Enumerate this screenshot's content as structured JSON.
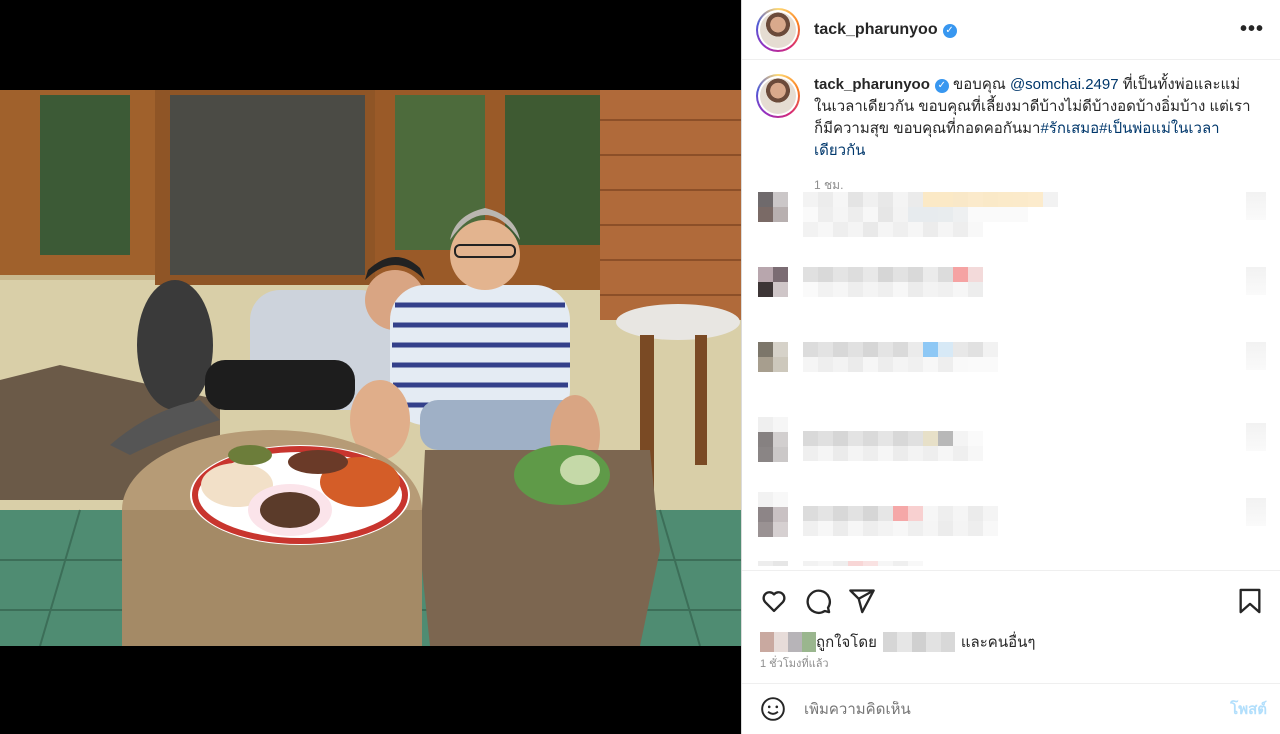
{
  "post": {
    "username": "tack_pharunyoo",
    "verified_glyph": "✓",
    "more_glyph": "•••"
  },
  "caption": {
    "username": "tack_pharunyoo",
    "text_before": "ขอบคุณ ",
    "mention": "@somchai.2497",
    "text_after": " ที่เป็นทั้งพ่อและแม่ในเวลาเดียวกัน ขอบคุณที่เลี้ยงมาดีบ้างไม่ดีบ้างอดบ้างอิ่มบ้าง แต่เราก็มีความสุข ขอบคุณที่กอดคอกันมา",
    "hashtags": "#รักเสมอ#เป็นพ่อแม่ในเวลาเดียวกัน",
    "age": "1 ชม."
  },
  "actions": {
    "like_icon": "heart-icon",
    "comment_icon": "comment-icon",
    "share_icon": "share-icon",
    "save_icon": "bookmark-icon"
  },
  "likes": {
    "prefix": "ถูกใจโดย",
    "suffix": "และคนอื่นๆ"
  },
  "posted_time": "1 ชั่วโมงที่แล้ว",
  "compose": {
    "placeholder": "เพิ่มความคิดเห็น",
    "post_label": "โพสต์"
  },
  "colors": {
    "link": "#00376b",
    "verified": "#3897f0",
    "muted": "#8e8e8e"
  }
}
